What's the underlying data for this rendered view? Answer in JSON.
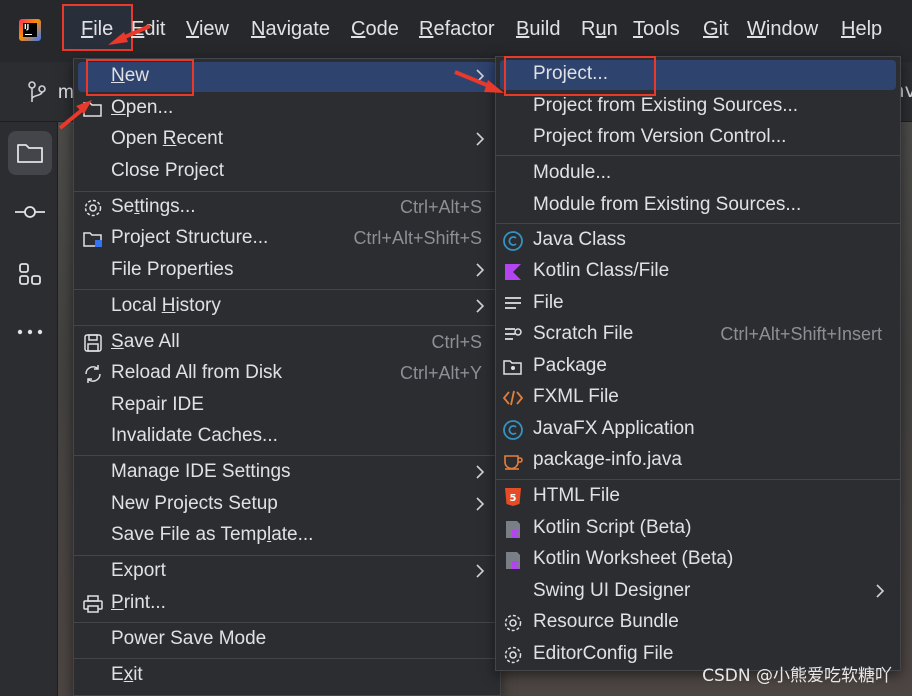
{
  "menubar": {
    "items": [
      {
        "pre": "",
        "mn": "F",
        "post": "ile"
      },
      {
        "pre": "",
        "mn": "E",
        "post": "dit"
      },
      {
        "pre": "",
        "mn": "V",
        "post": "iew"
      },
      {
        "pre": "",
        "mn": "N",
        "post": "avigate"
      },
      {
        "pre": "",
        "mn": "C",
        "post": "ode"
      },
      {
        "pre": "",
        "mn": "R",
        "post": "efactor"
      },
      {
        "pre": "",
        "mn": "B",
        "post": "uild"
      },
      {
        "pre": "R",
        "mn": "u",
        "post": "n"
      },
      {
        "pre": "",
        "mn": "T",
        "post": "ools"
      },
      {
        "pre": "",
        "mn": "G",
        "post": "it"
      },
      {
        "pre": "",
        "mn": "W",
        "post": "indow"
      },
      {
        "pre": "",
        "mn": "H",
        "post": "elp"
      }
    ]
  },
  "toolbar": {
    "branch_text": "m",
    "right_text": "av"
  },
  "file_menu": {
    "new": {
      "mn": "N",
      "post": "ew"
    },
    "open": {
      "mn": "O",
      "post": "pen..."
    },
    "open_recent": {
      "pre": "Open ",
      "mn": "R",
      "post": "ecent"
    },
    "close_project": "Close Project",
    "settings": {
      "pre": "Se",
      "mn": "t",
      "post": "tings...",
      "shortcut": "Ctrl+Alt+S"
    },
    "project_structure": {
      "label": "Project Structure...",
      "shortcut": "Ctrl+Alt+Shift+S"
    },
    "file_properties": "File Properties",
    "local_history": {
      "pre": "Local ",
      "mn": "H",
      "post": "istory"
    },
    "save_all": {
      "mn": "S",
      "post": "ave All",
      "shortcut": "Ctrl+S"
    },
    "reload": {
      "label": "Reload All from Disk",
      "shortcut": "Ctrl+Alt+Y"
    },
    "repair_ide": "Repair IDE",
    "invalidate_caches": "Invalidate Caches...",
    "manage_ide_settings": "Manage IDE Settings",
    "new_projects_setup": "New Projects Setup",
    "save_as_template": {
      "pre": "Save File as Temp",
      "mn": "l",
      "post": "ate..."
    },
    "export": "Export",
    "print": {
      "mn": "P",
      "post": "rint..."
    },
    "power_save_mode": "Power Save Mode",
    "exit": {
      "pre": "E",
      "mn": "x",
      "post": "it"
    }
  },
  "new_menu": {
    "project": "Project...",
    "project_existing": "Project from Existing Sources...",
    "project_vcs": "Project from Version Control...",
    "module": "Module...",
    "module_existing": "Module from Existing Sources...",
    "java_class": "Java Class",
    "kotlin_class": "Kotlin Class/File",
    "file": "File",
    "scratch_file": {
      "label": "Scratch File",
      "shortcut": "Ctrl+Alt+Shift+Insert"
    },
    "package": "Package",
    "fxml_file": "FXML File",
    "javafx_app": "JavaFX Application",
    "package_info": "package-info.java",
    "html_file": "HTML File",
    "kotlin_script": "Kotlin Script (Beta)",
    "kotlin_worksheet": "Kotlin Worksheet (Beta)",
    "swing_designer": "Swing UI Designer",
    "resource_bundle": "Resource Bundle",
    "editorconfig": "EditorConfig File"
  },
  "watermark": "CSDN @小熊爱吃软糖吖",
  "colors": {
    "accent_red": "#e8392a",
    "selection": "#2e436e",
    "background": "#2b2d30"
  }
}
